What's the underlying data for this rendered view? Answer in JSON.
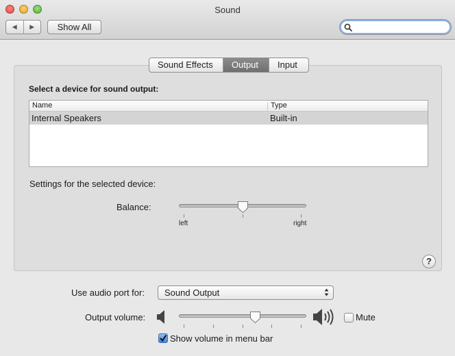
{
  "window": {
    "title": "Sound"
  },
  "toolbar": {
    "back_glyph": "◀",
    "forward_glyph": "▶",
    "show_all_label": "Show All",
    "search_placeholder": "",
    "search_value": ""
  },
  "tabs": [
    {
      "label": "Sound Effects",
      "selected": false
    },
    {
      "label": "Output",
      "selected": true
    },
    {
      "label": "Input",
      "selected": false
    }
  ],
  "output": {
    "section_label": "Select a device for sound output:",
    "table": {
      "columns": [
        "Name",
        "Type"
      ],
      "rows": [
        {
          "name": "Internal Speakers",
          "type": "Built-in",
          "selected": true
        }
      ]
    },
    "settings_label": "Settings for the selected device:",
    "balance": {
      "label": "Balance:",
      "left_label": "left",
      "right_label": "right",
      "value_fraction": 0.5
    },
    "help_label": "?"
  },
  "footer": {
    "audio_port_label": "Use audio port for:",
    "audio_port_value": "Sound Output",
    "output_volume_label": "Output volume:",
    "output_volume_fraction": 0.6,
    "mute_label": "Mute",
    "mute_checked": false,
    "show_volume_label": "Show volume in menu bar",
    "show_volume_checked": true
  },
  "colors": {
    "selected_tab": "#7d7d7d",
    "selected_row": "#d4d4d4",
    "checkbox_checked": "#3b86dc",
    "focus_ring": "#8cb2e4"
  }
}
